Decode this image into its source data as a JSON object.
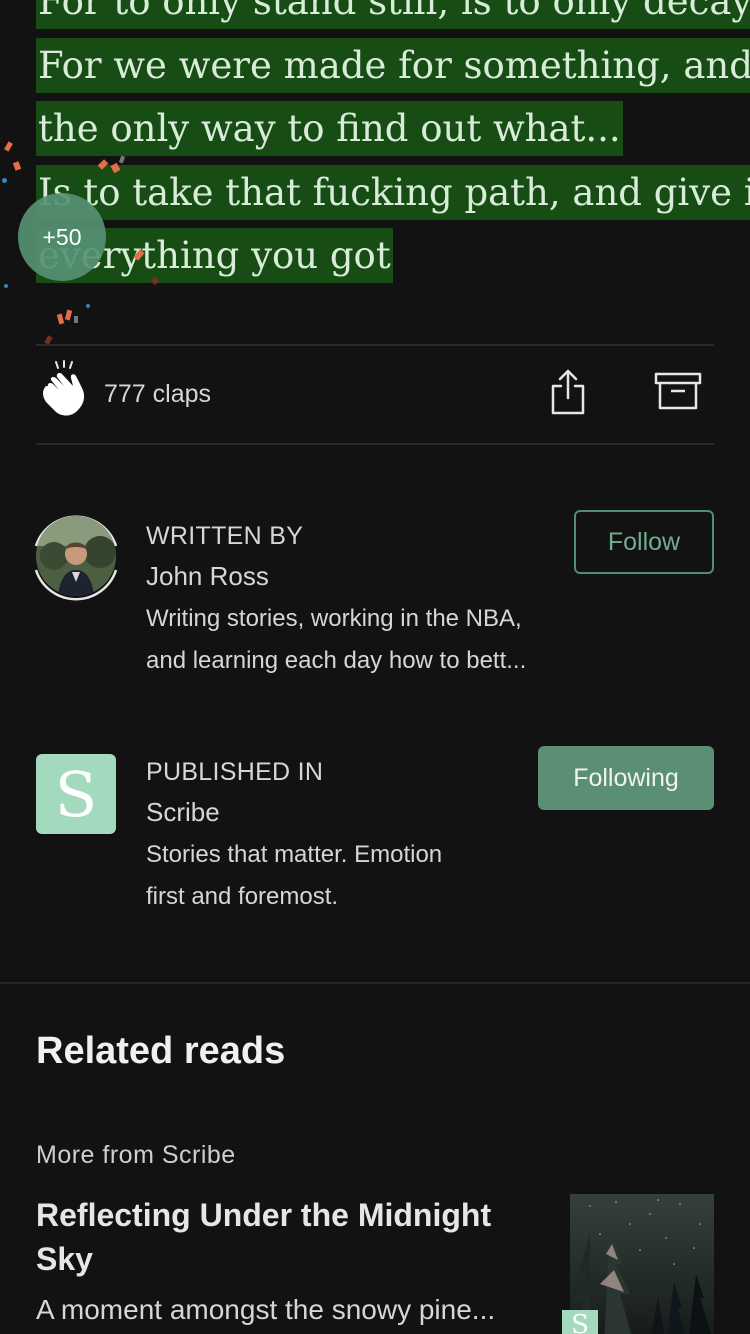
{
  "quote": {
    "lines": [
      "For to only stand still, is to only decay",
      "For we were made for something, and",
      "the only way to find out what...",
      "Is to take that fucking path, and give it",
      "everything you got"
    ]
  },
  "clap_badge": "+50",
  "actions": {
    "claps": "777 claps"
  },
  "author": {
    "kicker": "WRITTEN BY",
    "name": "John Ross",
    "bio_line1": "Writing stories, working in the NBA,",
    "bio_line2": "and learning each day how to bett...",
    "follow_label": "Follow"
  },
  "publication": {
    "kicker": "PUBLISHED IN",
    "name": "Scribe",
    "logo_letter": "S",
    "desc_line1": "Stories that matter. Emotion",
    "desc_line2": "first and foremost.",
    "following_label": "Following"
  },
  "related": {
    "heading": "Related reads",
    "source": "More from Scribe",
    "story_title_line1": "Reflecting Under the Midnight",
    "story_title_line2": "Sky",
    "story_subtitle": "A moment amongst the snowy pine...",
    "badge_letter": "S"
  },
  "colors": {
    "background": "#121212",
    "highlight": "#174d14",
    "accent_green": "#5a8f74",
    "logo_green": "#a3d9bc"
  }
}
